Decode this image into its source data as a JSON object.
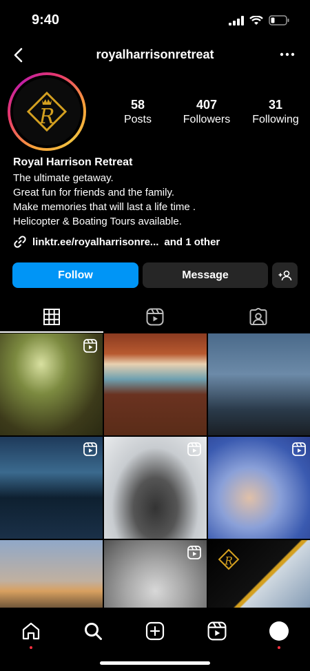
{
  "status_bar": {
    "time": "9:40"
  },
  "nav": {
    "username": "royalharrisonretreat"
  },
  "stats": {
    "posts": {
      "value": "58",
      "label": "Posts"
    },
    "followers": {
      "value": "407",
      "label": "Followers"
    },
    "following": {
      "value": "31",
      "label": "Following"
    }
  },
  "bio": {
    "name": "Royal Harrison Retreat",
    "lines": [
      "The ultimate getaway.",
      "Great fun for friends and the family.",
      "Make memories that will last a life time .",
      "Helicopter & Boating Tours available."
    ]
  },
  "link": {
    "text": "linktr.ee/royalharrisonre...",
    "other": "and 1 other"
  },
  "buttons": {
    "follow": "Follow",
    "message": "Message"
  },
  "tabs": [
    {
      "name": "grid-icon",
      "active": true
    },
    {
      "name": "reels-icon",
      "active": false
    },
    {
      "name": "tagged-icon",
      "active": false
    }
  ],
  "grid": [
    {
      "reel": true
    },
    {
      "reel": false
    },
    {
      "reel": false
    },
    {
      "reel": true
    },
    {
      "reel": true
    },
    {
      "reel": true
    },
    {
      "reel": false
    },
    {
      "reel": true
    },
    {
      "reel": false
    }
  ],
  "colors": {
    "accent": "#0095f6",
    "button_dark": "#262626",
    "logo_gold": "#d4a020",
    "notification": "#ff3040"
  }
}
